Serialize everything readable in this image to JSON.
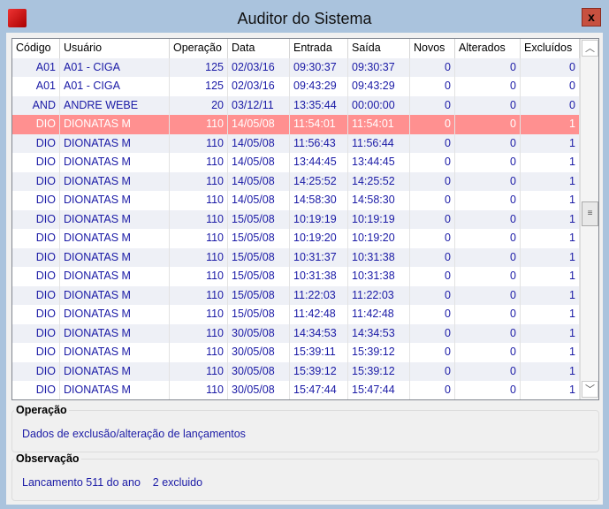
{
  "window": {
    "title": "Auditor do Sistema",
    "close_label": "x"
  },
  "columns": [
    "Código",
    "Usuário",
    "Operação",
    "Data",
    "Entrada",
    "Saída",
    "Novos",
    "Alterados",
    "Excluídos"
  ],
  "rows": [
    [
      "A01",
      "A01 - CIGA",
      "125",
      "02/03/16",
      "09:30:37",
      "09:30:37",
      "0",
      "0",
      "0"
    ],
    [
      "A01",
      "A01 - CIGA",
      "125",
      "02/03/16",
      "09:43:29",
      "09:43:29",
      "0",
      "0",
      "0"
    ],
    [
      "AND",
      "ANDRE WEBE",
      "20",
      "03/12/11",
      "13:35:44",
      "00:00:00",
      "0",
      "0",
      "0"
    ],
    [
      "DIO",
      "DIONATAS M",
      "110",
      "14/05/08",
      "11:54:01",
      "11:54:01",
      "0",
      "0",
      "1"
    ],
    [
      "DIO",
      "DIONATAS M",
      "110",
      "14/05/08",
      "11:56:43",
      "11:56:44",
      "0",
      "0",
      "1"
    ],
    [
      "DIO",
      "DIONATAS M",
      "110",
      "14/05/08",
      "13:44:45",
      "13:44:45",
      "0",
      "0",
      "1"
    ],
    [
      "DIO",
      "DIONATAS M",
      "110",
      "14/05/08",
      "14:25:52",
      "14:25:52",
      "0",
      "0",
      "1"
    ],
    [
      "DIO",
      "DIONATAS M",
      "110",
      "14/05/08",
      "14:58:30",
      "14:58:30",
      "0",
      "0",
      "1"
    ],
    [
      "DIO",
      "DIONATAS M",
      "110",
      "15/05/08",
      "10:19:19",
      "10:19:19",
      "0",
      "0",
      "1"
    ],
    [
      "DIO",
      "DIONATAS M",
      "110",
      "15/05/08",
      "10:19:20",
      "10:19:20",
      "0",
      "0",
      "1"
    ],
    [
      "DIO",
      "DIONATAS M",
      "110",
      "15/05/08",
      "10:31:37",
      "10:31:38",
      "0",
      "0",
      "1"
    ],
    [
      "DIO",
      "DIONATAS M",
      "110",
      "15/05/08",
      "10:31:38",
      "10:31:38",
      "0",
      "0",
      "1"
    ],
    [
      "DIO",
      "DIONATAS M",
      "110",
      "15/05/08",
      "11:22:03",
      "11:22:03",
      "0",
      "0",
      "1"
    ],
    [
      "DIO",
      "DIONATAS M",
      "110",
      "15/05/08",
      "11:42:48",
      "11:42:48",
      "0",
      "0",
      "1"
    ],
    [
      "DIO",
      "DIONATAS M",
      "110",
      "30/05/08",
      "14:34:53",
      "14:34:53",
      "0",
      "0",
      "1"
    ],
    [
      "DIO",
      "DIONATAS M",
      "110",
      "30/05/08",
      "15:39:11",
      "15:39:12",
      "0",
      "0",
      "1"
    ],
    [
      "DIO",
      "DIONATAS M",
      "110",
      "30/05/08",
      "15:39:12",
      "15:39:12",
      "0",
      "0",
      "1"
    ],
    [
      "DIO",
      "DIONATAS M",
      "110",
      "30/05/08",
      "15:47:44",
      "15:47:44",
      "0",
      "0",
      "1"
    ]
  ],
  "selected_row": 3,
  "operacao": {
    "label": "Operação",
    "value": "Dados de exclusão/alteração de lançamentos"
  },
  "observacao": {
    "label": "Observação",
    "value": "Lancamento 511 do ano    2 excluido"
  },
  "colors": {
    "selected": "#ff9090",
    "text": "#1a1aa6",
    "frame": "#aac3dd"
  }
}
